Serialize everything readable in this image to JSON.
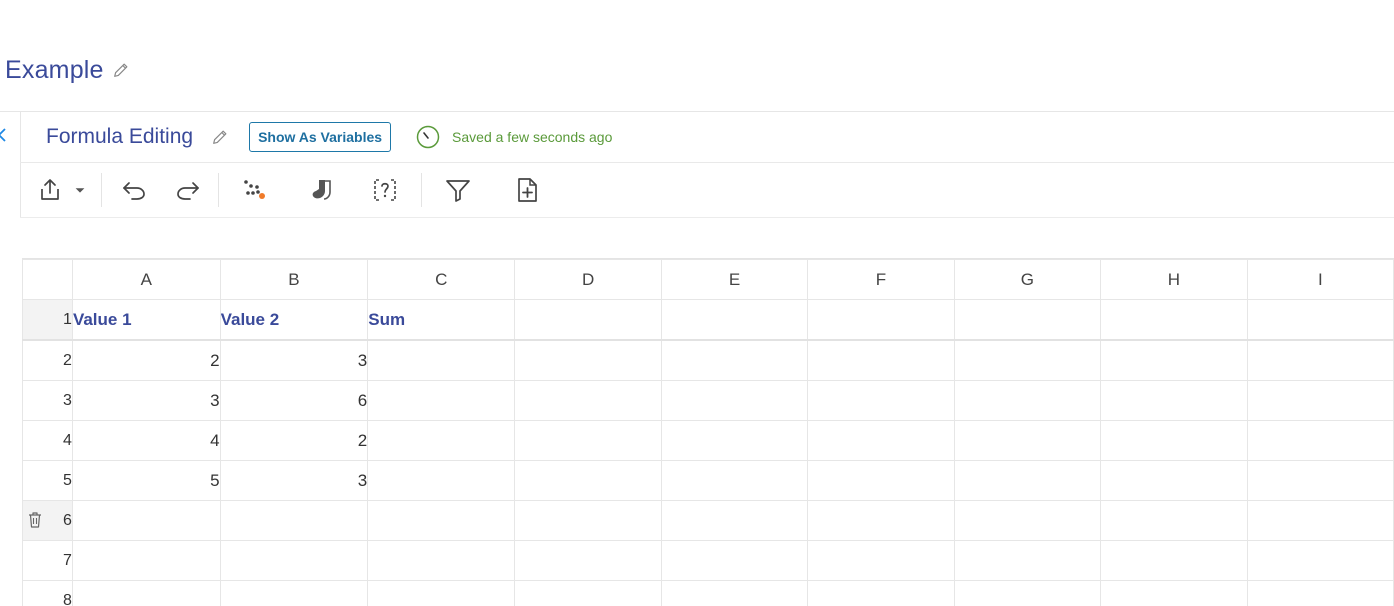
{
  "document": {
    "title": "Example"
  },
  "sheet": {
    "title": "Formula Editing",
    "show_variables_label": "Show As Variables",
    "saved_status": "Saved a few seconds ago"
  },
  "toolbar": {
    "buttons": [
      "export-icon",
      "dropdown-caret-icon",
      "undo-icon",
      "redo-icon",
      "scatter-dots-icon",
      "socks-icon",
      "bracket-question-icon",
      "filter-icon",
      "add-file-icon"
    ]
  },
  "grid": {
    "columns": [
      "A",
      "B",
      "C",
      "D",
      "E",
      "F",
      "G",
      "H",
      "I"
    ],
    "rows": [
      {
        "num": "1",
        "cells": [
          "Value 1",
          "Value 2",
          "Sum",
          "",
          "",
          "",
          "",
          "",
          ""
        ]
      },
      {
        "num": "2",
        "cells": [
          "2",
          "3",
          "",
          "",
          "",
          "",
          "",
          "",
          ""
        ]
      },
      {
        "num": "3",
        "cells": [
          "3",
          "6",
          "",
          "",
          "",
          "",
          "",
          "",
          ""
        ]
      },
      {
        "num": "4",
        "cells": [
          "4",
          "2",
          "",
          "",
          "",
          "",
          "",
          "",
          ""
        ]
      },
      {
        "num": "5",
        "cells": [
          "5",
          "3",
          "",
          "",
          "",
          "",
          "",
          "",
          ""
        ]
      },
      {
        "num": "6",
        "cells": [
          "",
          "",
          "",
          "",
          "",
          "",
          "",
          "",
          ""
        ]
      },
      {
        "num": "7",
        "cells": [
          "",
          "",
          "",
          "",
          "",
          "",
          "",
          "",
          ""
        ]
      },
      {
        "num": "8",
        "cells": [
          "",
          "",
          "",
          "",
          "",
          "",
          "",
          "",
          ""
        ]
      }
    ]
  },
  "colors": {
    "title": "#3a4a9a",
    "accent": "#1e78a8",
    "saved_green": "#5a9a3a",
    "orange": "#f07b2a"
  }
}
